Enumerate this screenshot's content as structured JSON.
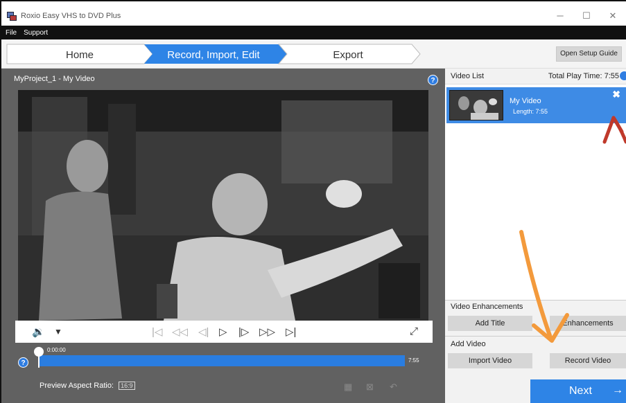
{
  "window": {
    "title": "Roxio Easy VHS to DVD Plus",
    "minimize": "─",
    "maximize": "☐",
    "close": "✕"
  },
  "menu": [
    "File",
    "Support"
  ],
  "nav": {
    "steps": [
      "Home",
      "Record, Import, Edit",
      "Export"
    ],
    "active_index": 1,
    "setup_button": "Open Setup Guide"
  },
  "preview": {
    "project_title": "MyProject_1 - My Video",
    "help": "?",
    "time_start": "0:00:00",
    "time_end": "7:55",
    "aspect_label": "Preview Aspect Ratio:",
    "aspect_value": "16:9",
    "position_fraction": 0.0
  },
  "controls": {
    "volume": "🔉",
    "volume_menu": "▼"
  },
  "video_list": {
    "title": "Video List",
    "total_time": "Total Play Time: 7:55",
    "items": [
      {
        "name": "My Video",
        "length": "Length: 7:55"
      }
    ]
  },
  "enhancements": {
    "title": "Video Enhancements",
    "add_title": "Add Title",
    "enhancements": "Enhancements"
  },
  "add_video": {
    "title": "Add Video",
    "import": "Import Video",
    "record": "Record Video"
  },
  "next": {
    "label": "Next",
    "arrow": "→"
  },
  "colors": {
    "accent": "#2e84e6",
    "selection": "#3e8be5",
    "preview_bg": "#616161",
    "annotation_red": "#c0392b",
    "annotation_orange": "#f39a3c"
  }
}
